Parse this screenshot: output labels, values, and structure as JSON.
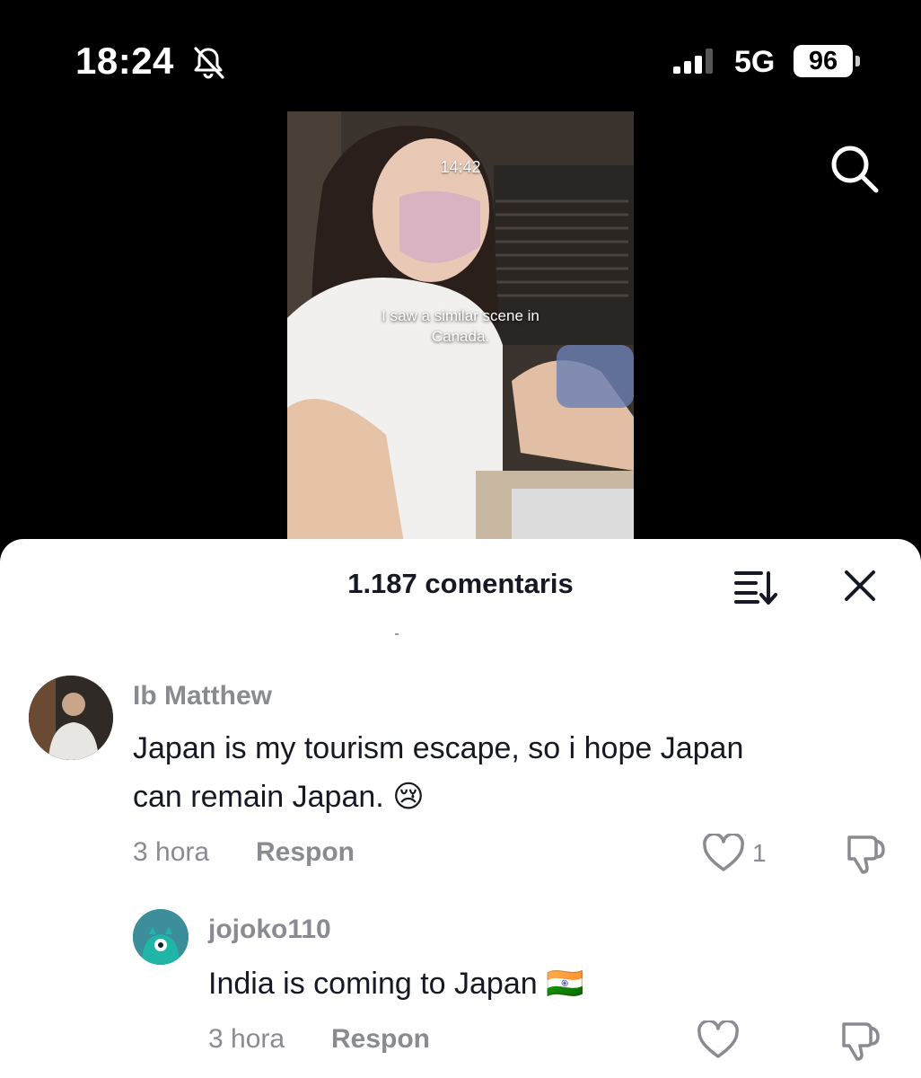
{
  "status": {
    "time": "18:24",
    "network": "5G",
    "battery": "96"
  },
  "video": {
    "timestamp": "14:42",
    "caption": "I saw a similar scene in Canada."
  },
  "comments_header": {
    "title": "1.187 comentaris"
  },
  "comments": [
    {
      "username": "Ib Matthew",
      "text_line1": "Japan is my tourism escape, so i hope Japan",
      "text_line2": "can remain Japan.",
      "emoji": "😢",
      "age": "3 hora",
      "reply_label": "Respon",
      "likes": "1"
    },
    {
      "username": "jojoko110",
      "text": "India is coming to Japan",
      "emoji": "🇮🇳",
      "age": "3 hora",
      "reply_label": "Respon"
    }
  ]
}
